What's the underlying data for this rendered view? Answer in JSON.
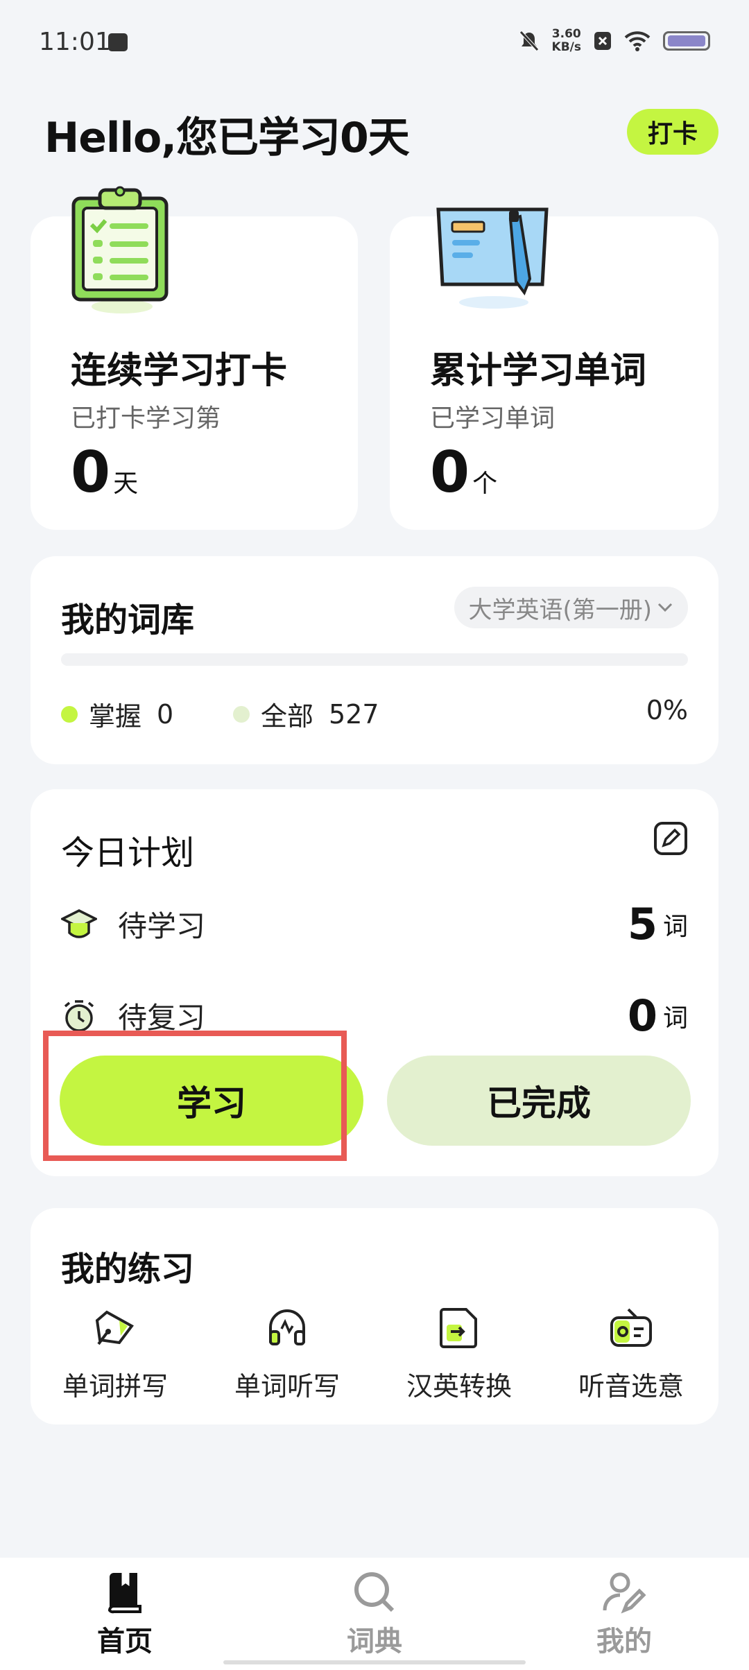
{
  "status_bar": {
    "time": "11:01",
    "speed_value": "3.60",
    "speed_unit": "KB/s"
  },
  "header": {
    "greeting": "Hello,您已学习0天",
    "checkin_label": "打卡"
  },
  "stats": {
    "streak": {
      "title": "连续学习打卡",
      "subtitle": "已打卡学习第",
      "value": "0",
      "unit": "天"
    },
    "words": {
      "title": "累计学习单词",
      "subtitle": "已学习单词",
      "value": "0",
      "unit": "个"
    }
  },
  "lexicon": {
    "title": "我的词库",
    "selected_book": "大学英语(第一册)",
    "mastered_label": "掌握",
    "mastered_value": "0",
    "total_label": "全部",
    "total_value": "527",
    "percent": "0%",
    "progress_fraction": 0
  },
  "plan": {
    "title": "今日计划",
    "to_learn_label": "待学习",
    "to_learn_value": "5",
    "to_review_label": "待复习",
    "to_review_value": "0",
    "unit": "词",
    "study_button": "学习",
    "done_button": "已完成"
  },
  "practice": {
    "title": "我的练习",
    "items": [
      {
        "label": "单词拼写",
        "icon": "pen-nib-icon"
      },
      {
        "label": "单词听写",
        "icon": "headphones-icon"
      },
      {
        "label": "汉英转换",
        "icon": "file-arrow-icon"
      },
      {
        "label": "听音选意",
        "icon": "radio-icon"
      }
    ]
  },
  "nav": {
    "home": "首页",
    "dictionary": "词典",
    "mine": "我的"
  },
  "colors": {
    "accent": "#c4f541",
    "accent_pale": "#e3f0cf",
    "highlight": "#e85a55"
  }
}
